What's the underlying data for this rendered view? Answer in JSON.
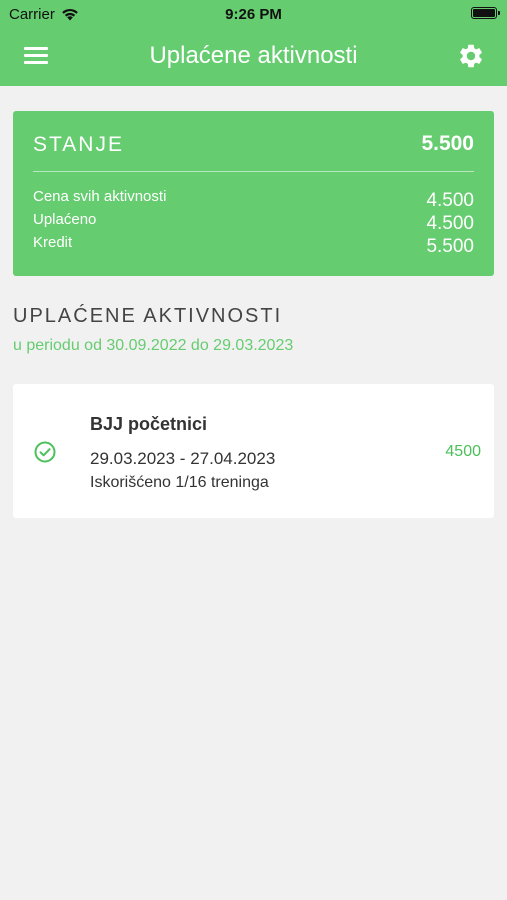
{
  "status_bar": {
    "carrier": "Carrier",
    "time": "9:26 PM",
    "battery_level_percent": 100
  },
  "nav": {
    "title": "Uplaćene aktivnosti",
    "menu_icon": "hamburger-menu-icon",
    "settings_icon": "gear-icon"
  },
  "balance": {
    "title": "STANJE",
    "total": "5.500",
    "rows": [
      {
        "label": "Cena svih aktivnosti",
        "value": "4.500"
      },
      {
        "label": "Uplaćeno",
        "value": "4.500"
      },
      {
        "label": "Kredit",
        "value": "5.500"
      }
    ]
  },
  "section": {
    "title": "UPLAĆENE AKTIVNOSTI",
    "subtitle": "u periodu od 30.09.2022 do 29.03.2023"
  },
  "activities": [
    {
      "name": "BJJ početnici",
      "dates": "29.03.2023 - 27.04.2023",
      "usage": "Iskorišćeno 1/16 treninga",
      "price": "4500",
      "status_icon": "check-circle-icon"
    }
  ],
  "colors": {
    "accent": "#66cc70",
    "background": "#f1f1f1",
    "card": "#ffffff",
    "price": "#4cc05a"
  }
}
